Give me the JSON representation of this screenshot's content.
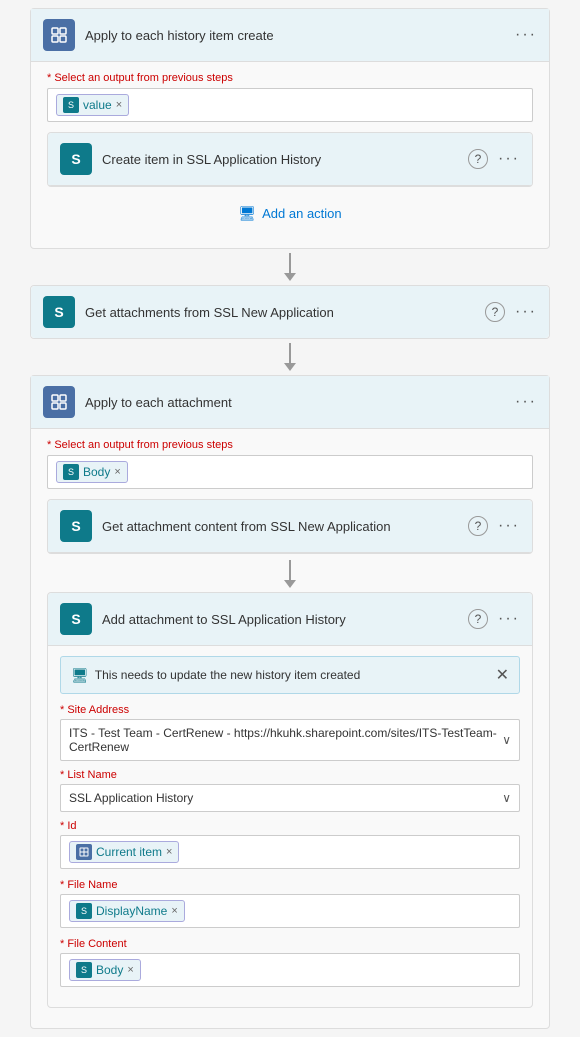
{
  "page": {
    "background": "#f5f5f5"
  },
  "loopCreate": {
    "title": "Apply to each history item create",
    "selectLabel": "* Select an output from previous steps",
    "token": "value",
    "addActionLabel": "Add an action",
    "innerAction": {
      "title": "Create item in SSL Application History"
    }
  },
  "getAttachments": {
    "title": "Get attachments from SSL New Application"
  },
  "loopAttachment": {
    "title": "Apply to each attachment",
    "selectLabel": "* Select an output from previous steps",
    "token": "Body",
    "getContent": {
      "title": "Get attachment content from SSL New Application"
    },
    "addAttachment": {
      "title": "Add attachment to SSL Application History",
      "infoText": "This needs to update the new history item created",
      "fields": [
        {
          "label": "* Site Address",
          "type": "select",
          "value": "ITS - Test Team - CertRenew - https://hkuhk.sharepoint.com/sites/ITS-TestTeam-CertRenew"
        },
        {
          "label": "* List Name",
          "type": "select",
          "value": "SSL Application History"
        },
        {
          "label": "* Id",
          "type": "token",
          "tokenLabel": "Current item",
          "tokenIcon": "loop"
        },
        {
          "label": "* File Name",
          "type": "token",
          "tokenLabel": "DisplayName",
          "tokenIcon": "s"
        },
        {
          "label": "* File Content",
          "type": "token",
          "tokenLabel": "Body",
          "tokenIcon": "s"
        }
      ]
    }
  }
}
